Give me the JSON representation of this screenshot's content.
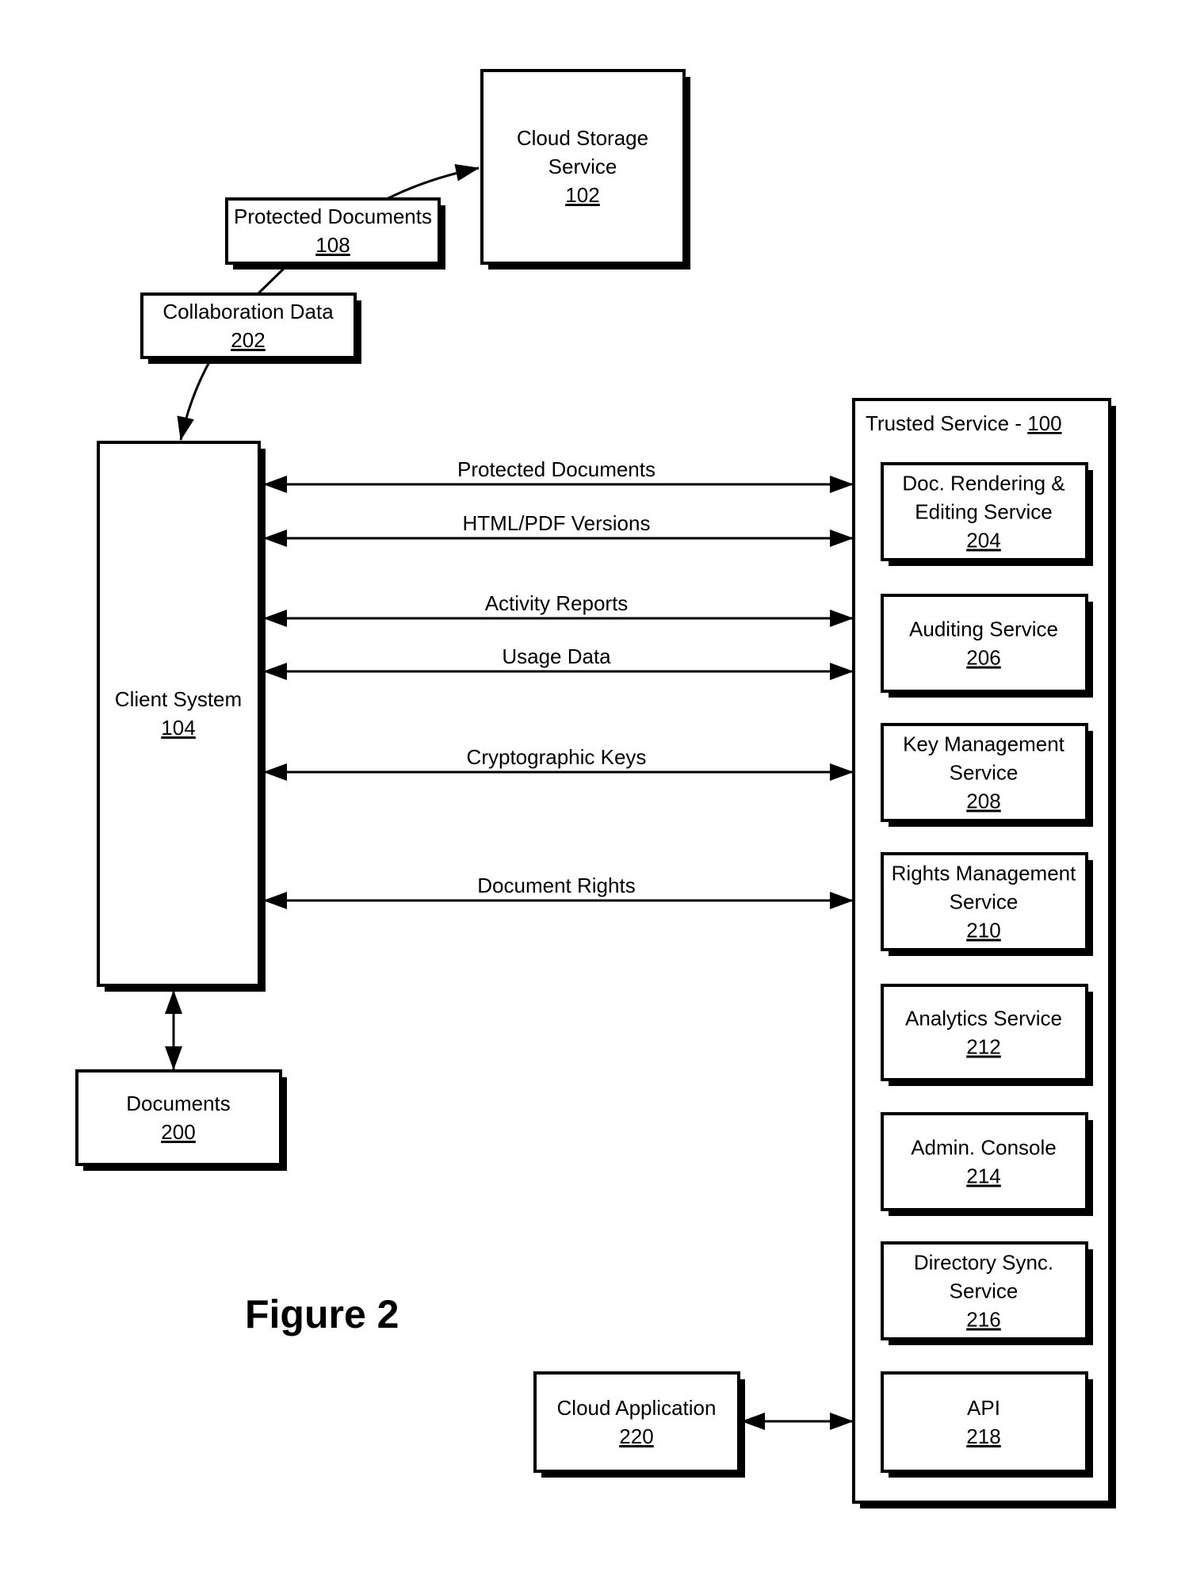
{
  "figure_label": "Figure 2",
  "nodes": {
    "cloud_storage": {
      "lines": [
        "Cloud Storage",
        "Service"
      ],
      "ref": "102"
    },
    "protected_docs": {
      "lines": [
        "Protected Documents"
      ],
      "ref": "108"
    },
    "collab_data": {
      "lines": [
        "Collaboration Data"
      ],
      "ref": "202"
    },
    "client": {
      "lines": [
        "Client System"
      ],
      "ref": "104"
    },
    "documents": {
      "lines": [
        "Documents"
      ],
      "ref": "200"
    },
    "cloud_app": {
      "lines": [
        "Cloud Application"
      ],
      "ref": "220"
    },
    "trusted": {
      "title": "Trusted Service - ",
      "ref": "100"
    }
  },
  "services": [
    {
      "lines": [
        "Doc. Rendering &",
        "Editing Service"
      ],
      "ref": "204"
    },
    {
      "lines": [
        "Auditing Service"
      ],
      "ref": "206"
    },
    {
      "lines": [
        "Key Management",
        "Service"
      ],
      "ref": "208"
    },
    {
      "lines": [
        "Rights Management",
        "Service"
      ],
      "ref": "210"
    },
    {
      "lines": [
        "Analytics Service"
      ],
      "ref": "212"
    },
    {
      "lines": [
        "Admin. Console"
      ],
      "ref": "214"
    },
    {
      "lines": [
        "Directory Sync.",
        "Service"
      ],
      "ref": "216"
    },
    {
      "lines": [
        "API"
      ],
      "ref": "218"
    }
  ],
  "flows": [
    "Protected Documents",
    "HTML/PDF Versions",
    "Activity Reports",
    "Usage Data",
    "Cryptographic Keys",
    "Document Rights"
  ]
}
